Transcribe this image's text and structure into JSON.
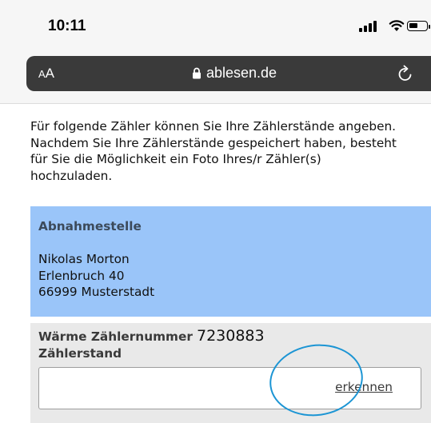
{
  "status_bar": {
    "time": "10:11",
    "icons": [
      "signal-icon",
      "wifi-icon",
      "battery-icon"
    ]
  },
  "browser": {
    "text_size_button": {
      "small": "A",
      "large": "A"
    },
    "url": "ablesen.de",
    "lock_icon": "lock-icon",
    "reload_icon": "reload-icon"
  },
  "page": {
    "intro": "Für folgende Zähler können Sie Ihre Zählerstände angeben. Nachdem Sie Ihre Zählerstände gespeichert haben, besteht für Sie die Möglichkeit ein Foto Ihres/r Zähler(s) hochzuladen.",
    "location": {
      "heading": "Abnahmestelle",
      "name": "Nikolas Morton",
      "street": "Erlenbruch 40",
      "city": "66999 Musterstadt"
    },
    "meter": {
      "label": "Wärme Zählernummer",
      "number": "7230883",
      "reading_label": "Zählerstand",
      "reading_value": "",
      "recognize_link": "erkennen"
    }
  },
  "colors": {
    "location_background": "#9ac5f9",
    "meter_background": "#e9e9e9",
    "address_bar_background": "#3a3a3a",
    "highlight_circle": "#1c95d4"
  }
}
